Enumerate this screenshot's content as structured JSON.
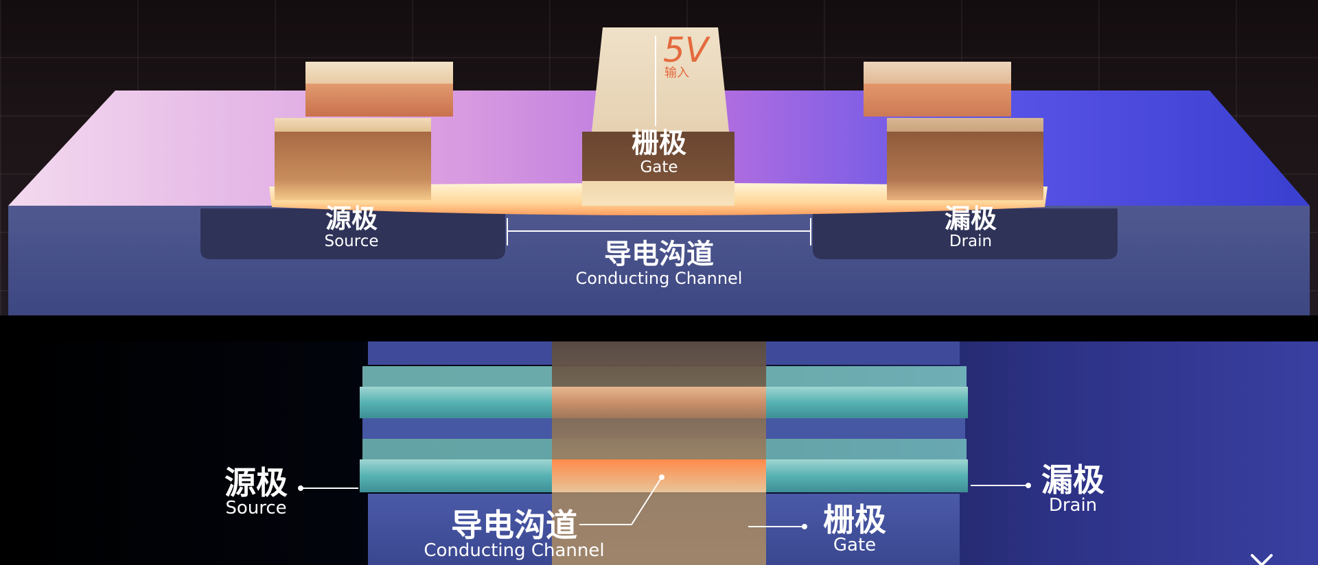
{
  "top": {
    "source": {
      "cn": "源极",
      "en": "Source"
    },
    "drain": {
      "cn": "漏极",
      "en": "Drain"
    },
    "gate": {
      "cn": "栅极",
      "en": "Gate"
    },
    "channel": {
      "cn": "导电沟道",
      "en": "Conducting Channel"
    },
    "voltage": {
      "value": "5V",
      "caption": "输入"
    }
  },
  "bottom": {
    "source": {
      "cn": "源极",
      "en": "Source"
    },
    "drain": {
      "cn": "漏极",
      "en": "Drain"
    },
    "gate": {
      "cn": "栅极",
      "en": "Gate"
    },
    "channel": {
      "cn": "导电沟道",
      "en": "Conducting Channel"
    }
  },
  "colors": {
    "voltage_accent": "#e46a3e",
    "channel_glow": "#ffe9b8",
    "substrate": "#3f4a86",
    "fin_teal": "#4fb1b3"
  },
  "icons": [
    "close-icon"
  ]
}
